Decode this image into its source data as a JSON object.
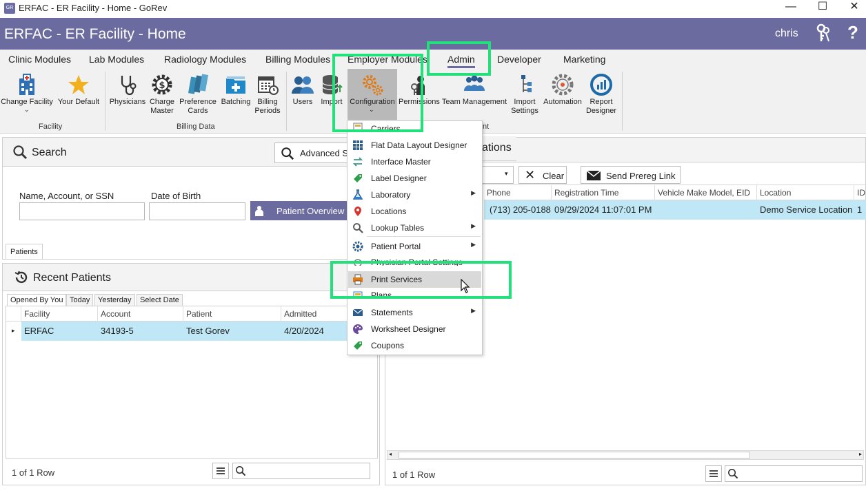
{
  "window": {
    "title": "ERFAC - ER Facility - Home - GoRev",
    "app_icon": "GR",
    "minimize": "—",
    "maximize": "☐",
    "close": "✕"
  },
  "header": {
    "title": "ERFAC - ER Facility - Home",
    "user": "chris",
    "help": "?"
  },
  "ribbon": {
    "tabs": [
      "Clinic Modules",
      "Lab Modules",
      "Radiology Modules",
      "Billing Modules",
      "Employer Modules",
      "Admin",
      "Developer",
      "Marketing"
    ],
    "active_tab": "Admin",
    "groups": {
      "facility": "Facility",
      "billing_data": "Billing Data",
      "admin_tail": "nt"
    },
    "buttons": {
      "change_facility": "Change Facility",
      "your_default": "Your Default",
      "physicians": "Physicians",
      "charge_master_1": "Charge",
      "charge_master_2": "Master",
      "preference_cards_1": "Preference",
      "preference_cards_2": "Cards",
      "batching": "Batching",
      "billing_periods_1": "Billing",
      "billing_periods_2": "Periods",
      "users": "Users",
      "import": "Import",
      "configuration": "Configuration",
      "permissions": "Permissions",
      "team_management": "Team Management",
      "import_settings_1": "Import",
      "import_settings_2": "Settings",
      "automation": "Automation",
      "report_designer_1": "Report",
      "report_designer_2": "Designer"
    }
  },
  "search": {
    "title": "Search",
    "advanced": "Advanced Se",
    "name_label": "Name, Account, or SSN",
    "dob_label": "Date of Birth",
    "name_value": "",
    "dob_value": "",
    "patient_overview": "Patient Overview",
    "tab": "Patients"
  },
  "recent": {
    "title": "Recent Patients",
    "tabs": [
      "Opened By You",
      "Today",
      "Yesterday",
      "Select Date"
    ],
    "columns": [
      "Facility",
      "Account",
      "Patient",
      "Admitted"
    ],
    "rows": [
      {
        "facility": "ERFAC",
        "account": "34193-5",
        "patient": "Test Gorev",
        "admitted": "4/20/2024"
      }
    ],
    "row_count": "1 of 1 Row"
  },
  "right": {
    "tab": "ations",
    "clear": "Clear",
    "send_prereg": "Send Prereg Link",
    "columns": [
      "Phone",
      "Registration Time",
      "Vehicle Make Model, EID",
      "Location",
      "ID"
    ],
    "rows": [
      {
        "phone": "(713) 205-0188",
        "registration_time": "09/29/2024 11:07:01 PM",
        "vehicle": "",
        "location": "Demo Service Location",
        "id": "1"
      }
    ],
    "row_count": "1 of 1 Row"
  },
  "menu": {
    "items": [
      {
        "label": "Carriers",
        "icon": "carriers-icon",
        "submenu": false
      },
      {
        "label": "Flat Data Layout Designer",
        "icon": "grid-icon",
        "submenu": false
      },
      {
        "label": "Interface Master",
        "icon": "interface-icon",
        "submenu": false
      },
      {
        "label": "Label Designer",
        "icon": "tag-icon",
        "submenu": false
      },
      {
        "label": "Laboratory",
        "icon": "flask-icon",
        "submenu": true
      },
      {
        "label": "Locations",
        "icon": "pin-icon",
        "submenu": false
      },
      {
        "label": "Lookup Tables",
        "icon": "magnifier-icon",
        "submenu": true
      },
      {
        "label": "Patient Portal",
        "icon": "portal-gear-icon",
        "submenu": true
      },
      {
        "label": "Physician Portal Settings",
        "icon": "physician-portal-icon",
        "submenu": false
      },
      {
        "label": "Print Services",
        "icon": "printer-icon",
        "submenu": false
      },
      {
        "label": "Plans",
        "icon": "plans-icon",
        "submenu": false
      },
      {
        "label": "Statements",
        "icon": "envelope-icon",
        "submenu": true
      },
      {
        "label": "Worksheet Designer",
        "icon": "palette-icon",
        "submenu": false
      },
      {
        "label": "Coupons",
        "icon": "coupon-icon",
        "submenu": false
      }
    ],
    "highlighted": "Print Services"
  },
  "colors": {
    "header": "#6b6ba0",
    "ribbon": "#f1f1f1",
    "selection": "#bfe7f5",
    "highlight_box": "#22e07a"
  }
}
